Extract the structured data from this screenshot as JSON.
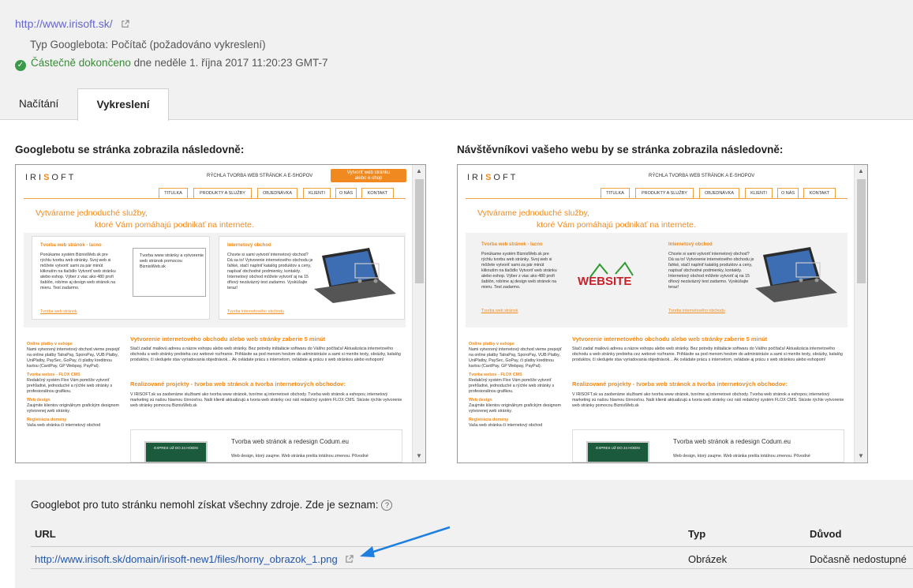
{
  "header": {
    "url": "http://www.irisoft.sk/",
    "googlebot_type": "Typ Googlebota: Počítač (požadováno vykreslení)",
    "status": "Částečně dokončeno",
    "status_date": "dne neděle 1. října 2017 11:20:23 GMT-7"
  },
  "tabs": [
    {
      "label": "Načítání"
    },
    {
      "label": "Vykreslení"
    }
  ],
  "panels": {
    "googlebot_title": "Googlebotu se stránka zobrazila následovně:",
    "visitor_title": "Návštěvníkovi vašeho webu by se stránka zobrazila následovně:"
  },
  "site": {
    "logo_a": "IRI",
    "logo_b": "S",
    "logo_c": "OFT",
    "tagline": "RÝCHLA TVORBA WEB STRÁNOK A E-SHOPOV",
    "cta_line1": "Vytvoriť web stránku",
    "cta_line2": "alebo e-shop",
    "menu": [
      "TITULKA",
      "PRODUKTY A SLUŽBY",
      "OBJEDNÁVKA",
      "KLIENTI",
      "O NÁS",
      "KONTAKT"
    ],
    "headline1": "Vytvárame jednoduché služby,",
    "headline2": "ktoré Vám pomáhajú podnikať na internete.",
    "card1_title": "Tvorba web stránok - lacno",
    "card1_text": "Ponúkame systém BiznisWeb.sk pre rýchlu tvorbu web stránky. Svoj web si môžete vytvoriť sami za pár minút kliknutím na tlačidlo Vytvoriť web stránku alebo eshop. Výber z viac ako 480 profi šablón, robíme aj design web stránok na mieru. Test zadarmo.",
    "card1_link": "Tvorba web stránok",
    "placeholder_text": "Tvorba www stránky a vytvorenie web stránok pomocou BiznisWeb.sk",
    "website_word": "WEBSITE",
    "card2_title": "Internetový obchod",
    "card2_text": "Chcete si sami vytvoriť internetový obchod? Dá sa to! Vytvorenie internetového obchodu je ľahké, stačí naplniť katalóg produktov a ceny, napísať obchodné podmienky, kontakty. Internetový obchod môžete vytvoriť aj na 15 dňový nezáväzný test zadarmo. Vyskúšajte teraz!",
    "card2_link": "Tvorba internetového obchodu",
    "sidebar": [
      {
        "h": "Online platby v eshope",
        "t": "Nami vytvorený internetový obchod vieme prepojiť na online platby TatraPay, SporoPay, VUB Platby, UniPlatby, PaySec, GoPay, či platby kreditnou kartou (CardPay, GP Webpay, PayPal)."
      },
      {
        "h": "Tvorba webov - FLOX CMS",
        "t": "Redakčný systém Flox Vám pomôže vytvoriť prehľadné, jednoduché a rýchle web stránky s profesionálnou grafikou."
      },
      {
        "h": "Web design",
        "t": "Zaujmite klientov originálnym grafickým designom vytvorenej web stránky."
      },
      {
        "h": "Registrácia domény",
        "t": "Vaša web stránka či internetový obchod"
      }
    ],
    "section1_title": "Vytvorenie internetového obchodu alebo web stránky zaberie 5 minút",
    "section1_text": "Stačí zadať mailovú adresu a názov eshopu alebo web stránky. Bez potreby inštalácie softwaru do Vášho počítača! Aktualizácia internetového obchodu a web stránky prebieha cez webové rozhranie. Prihlásite sa pod menom heslom do administrácie a sami si meníte texty, obrázky, katalóg produktov, či sledujete stav vyriadovania objednávok... Ak ovládate prácu s internetom, ovládate aj prácu s web stránkou alebo eshopom!",
    "section2_title": "Realizované projekty - tvorba web stránok a tvorba internetových obchodov:",
    "section2_text": "V IRISOFT.sk sa zaoberáme službami ako tvorba www stránok, tvoríme aj internetové obchody. Tvorba web stránok a eshopov, internetový marketing sú našou hlavnou činnosťou. Naši klienti aktualizujú a tvoria web stránky cez náš redakčný systém FLOX CMS. Skúste rýchle vytvorenie web stránky pomocou BiznisWeb.sk",
    "project_title": "Tvorba web stránok a redesign Codum.eu",
    "project_text": "Web design, ktorý zaujme. Web stránka prešla totálnou zmenou. Pôvodné",
    "project_badge": "EXPRES UŽ DO 24 HODIN"
  },
  "resources": {
    "title": "Googlebot pro tuto stránku nemohl získat všechny zdroje. Zde je seznam:",
    "columns": [
      "URL",
      "Typ",
      "Důvod"
    ],
    "rows": [
      {
        "url": "http://www.irisoft.sk/domain/irisoft-new1/files/horny_obrazok_1.png",
        "type": "Obrázek",
        "reason": "Dočasně nedostupné"
      }
    ]
  },
  "colors": {
    "accent": "#f08a1c",
    "link": "#2255aa",
    "visited": "#66c",
    "ok": "#3a8a3a",
    "arrow": "#1e7fe0"
  }
}
